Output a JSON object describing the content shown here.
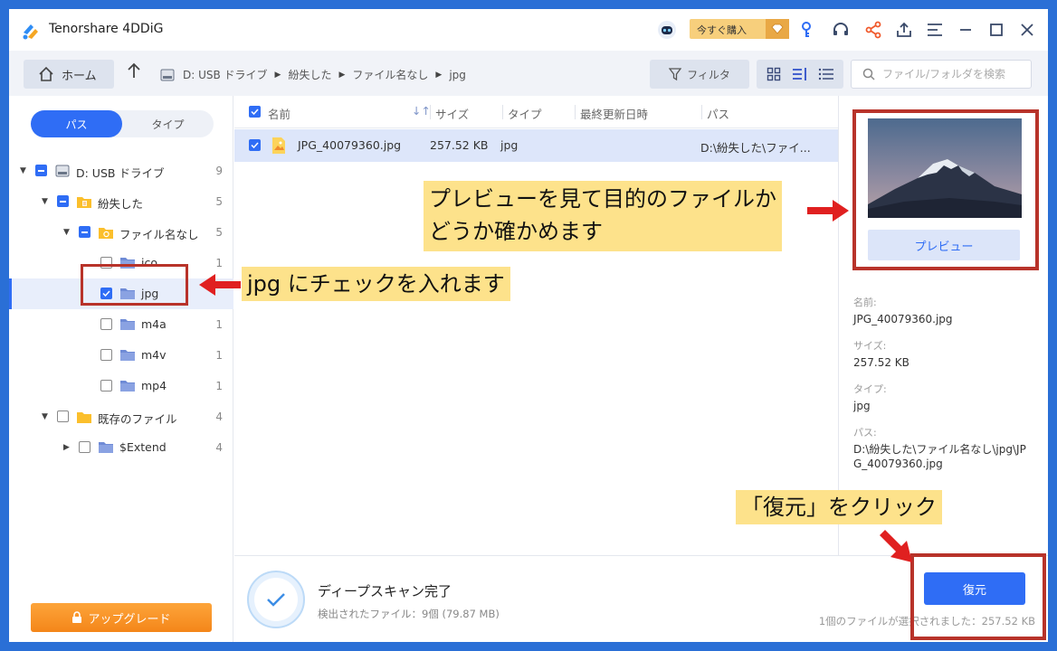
{
  "app": {
    "title": "Tenorshare 4DDiG"
  },
  "header": {
    "buy_label": "今すぐ購入"
  },
  "nav": {
    "home_label": "ホーム",
    "breadcrumb": [
      "D: USB ドライブ",
      "紛失した",
      "ファイル名なし",
      "jpg"
    ],
    "filter_label": "フィルタ",
    "search_placeholder": "ファイル/フォルダを検索"
  },
  "sidebar": {
    "tabs": [
      {
        "label": "パス",
        "active": true
      },
      {
        "label": "タイプ",
        "active": false
      }
    ],
    "tree": [
      {
        "label": "D: USB ドライブ",
        "count": "9",
        "depth": 0,
        "check": "partial",
        "icon": "drive-icon",
        "expander": "open"
      },
      {
        "label": "紛失した",
        "count": "5",
        "depth": 1,
        "check": "partial",
        "icon": "lost-folder-icon",
        "expander": "open"
      },
      {
        "label": "ファイル名なし",
        "count": "5",
        "depth": 2,
        "check": "partial",
        "icon": "unnamed-folder-icon",
        "expander": "open"
      },
      {
        "label": "ico",
        "count": "1",
        "depth": 3,
        "check": "none",
        "icon": "folder-icon",
        "expander": "none"
      },
      {
        "label": "jpg",
        "count": "",
        "depth": 3,
        "check": "checked",
        "icon": "folder-icon",
        "expander": "none",
        "selected": true
      },
      {
        "label": "m4a",
        "count": "1",
        "depth": 3,
        "check": "none",
        "icon": "folder-icon",
        "expander": "none"
      },
      {
        "label": "m4v",
        "count": "1",
        "depth": 3,
        "check": "none",
        "icon": "folder-icon",
        "expander": "none"
      },
      {
        "label": "mp4",
        "count": "1",
        "depth": 3,
        "check": "none",
        "icon": "folder-icon",
        "expander": "none"
      },
      {
        "label": "既存のファイル",
        "count": "4",
        "depth": 1,
        "check": "none",
        "icon": "existing-folder-icon",
        "expander": "open"
      },
      {
        "label": "$Extend",
        "count": "4",
        "depth": 2,
        "check": "none",
        "icon": "folder-icon",
        "expander": "closed"
      }
    ],
    "upgrade_label": "アップグレード"
  },
  "filelist": {
    "columns": {
      "name": "名前",
      "size": "サイズ",
      "type": "タイプ",
      "modified": "最終更新日時",
      "path": "パス"
    },
    "rows": [
      {
        "name": "JPG_40079360.jpg",
        "size": "257.52 KB",
        "type": "jpg",
        "modified": "",
        "path": "D:\\紛失した\\ファイ..."
      }
    ]
  },
  "details": {
    "preview_button": "プレビュー",
    "name_label": "名前:",
    "name_value": "JPG_40079360.jpg",
    "size_label": "サイズ:",
    "size_value": "257.52 KB",
    "type_label": "タイプ:",
    "type_value": "jpg",
    "path_label": "パス:",
    "path_value": "D:\\紛失した\\ファイル名なし\\jpg\\JPG_40079360.jpg"
  },
  "status": {
    "title": "ディープスキャン完了",
    "subtitle": "検出されたファイル：9個 (79.87 MB)",
    "selection": "1個のファイルが選択されました：257.52 KB",
    "recover_label": "復元"
  },
  "annotations": {
    "preview_note": [
      "プレビューを見て目的のファイルか",
      "どうか確かめます"
    ],
    "jpg_note": "jpg にチェックを入れます",
    "recover_note": "「復元」をクリック"
  },
  "colors": {
    "accent": "#2f6df5",
    "frame": "#2a6fd6",
    "callout": "#fde28b",
    "highlight_box": "#b8332a"
  }
}
